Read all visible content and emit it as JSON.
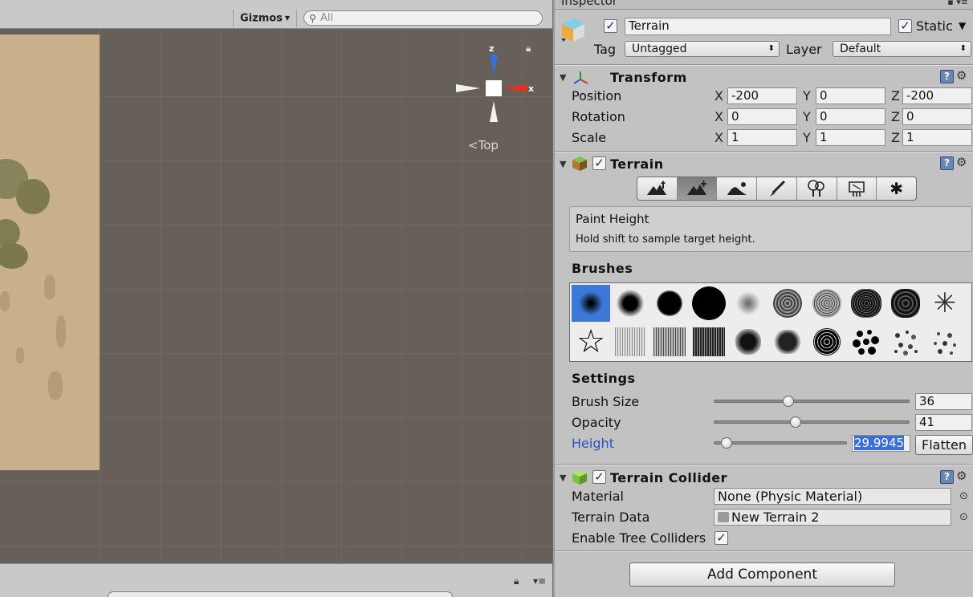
{
  "scene": {
    "gizmos_label": "Gizmos",
    "search_placeholder": "All",
    "view_label": "Top",
    "gizmo_axes": {
      "z": "z",
      "x": "x"
    }
  },
  "inspector": {
    "tab_label": "Inspector",
    "object": {
      "name": "Terrain",
      "active": true,
      "static_label": "Static",
      "static": true,
      "tag_label": "Tag",
      "tag_value": "Untagged",
      "layer_label": "Layer",
      "layer_value": "Default"
    },
    "transform": {
      "title": "Transform",
      "rows": [
        {
          "label": "Position",
          "x": "-200",
          "y": "0",
          "z": "-200"
        },
        {
          "label": "Rotation",
          "x": "0",
          "y": "0",
          "z": "0"
        },
        {
          "label": "Scale",
          "x": "1",
          "y": "1",
          "z": "1"
        }
      ],
      "axis_labels": [
        "X",
        "Y",
        "Z"
      ]
    },
    "terrain": {
      "title": "Terrain",
      "enabled": true,
      "tools": [
        {
          "name": "raise-lower-icon",
          "active": false
        },
        {
          "name": "paint-height-icon",
          "active": true
        },
        {
          "name": "smooth-height-icon",
          "active": false
        },
        {
          "name": "paint-texture-icon",
          "active": false
        },
        {
          "name": "place-trees-icon",
          "active": false
        },
        {
          "name": "paint-details-icon",
          "active": false
        },
        {
          "name": "terrain-settings-icon",
          "active": false
        }
      ],
      "tool_title": "Paint Height",
      "tool_hint": "Hold shift to sample target height.",
      "brushes_heading": "Brushes",
      "settings_heading": "Settings",
      "settings": {
        "brush_size_label": "Brush Size",
        "brush_size": "36",
        "brush_size_fraction": 0.37,
        "opacity_label": "Opacity",
        "opacity": "41",
        "opacity_fraction": 0.41,
        "height_label": "Height",
        "height": "29.9945",
        "height_fraction": 0.05,
        "flatten_label": "Flatten"
      }
    },
    "collider": {
      "title": "Terrain Collider",
      "enabled": true,
      "material_label": "Material",
      "material_value": "None (Physic Material)",
      "terrain_data_label": "Terrain Data",
      "terrain_data_value": "New Terrain 2",
      "tree_colliders_label": "Enable Tree Colliders",
      "tree_colliders": true
    },
    "add_component_label": "Add Component",
    "colors": {
      "selection": "#3b78d8",
      "height_label": "#2a54c6",
      "gizmo_x": "#e0321e",
      "gizmo_z": "#3a6ed8"
    }
  }
}
